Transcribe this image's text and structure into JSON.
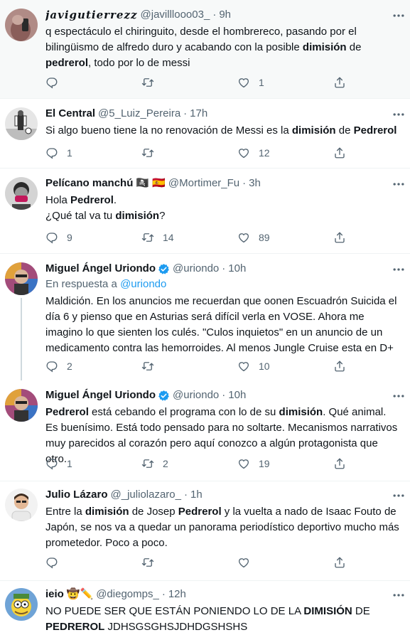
{
  "tweets": [
    {
      "name": "javigutierrezz",
      "handle": "@javilllooo03_",
      "time": "9h",
      "text_html": "q espectáculo el chiringuito, desde el hombrereco, pasando por el bilingüismo de alfredo duro y acabando con la posible <b>dimisión</b> de <b>pedrerol</b>, todo por lo de messi",
      "replies": "",
      "retweets": "",
      "likes": "1"
    },
    {
      "name": "El Central",
      "handle": "@5_Luiz_Pereira",
      "time": "17h",
      "text_html": "Si algo bueno tiene la no renovación de Messi es la <b>dimisión</b> de <b>Pedrerol</b>",
      "replies": "1",
      "retweets": "",
      "likes": "12"
    },
    {
      "name": "Pelícano manchú",
      "name_emoji": "🏴‍☠️ 🇪🇸",
      "handle": "@Mortimer_Fu",
      "time": "3h",
      "text_html": "Hola <b>Pedrerol</b>.<br>¿Qué tal va tu <b>dimisión</b>?",
      "replies": "9",
      "retweets": "14",
      "likes": "89"
    },
    {
      "name": "Miguel Ángel Uriondo",
      "handle": "@uriondo",
      "time": "10h",
      "reply_prefix": "En respuesta a",
      "reply_to": "@uriondo",
      "text_html": "Maldición. En los anuncios me recuerdan que oonen Escuadrón Suicida el día 6 y pienso que en Asturias será difícil verla en VOSE. Ahora me imagino lo que sienten los culés. \"Culos inquietos\" en un anuncio de un medicamento contra las hemorroides. Al menos Jungle Cruise esta en D+",
      "replies": "2",
      "retweets": "",
      "likes": "10"
    },
    {
      "name": "Miguel Ángel Uriondo",
      "handle": "@uriondo",
      "time": "10h",
      "text_html": "<b>Pedrerol</b> está cebando el programa con lo de su <b>dimisión</b>. Qué animal. Es buenísimo. Está todo pensado para no soltarte. Mecanismos narrativos muy parecidos al corazón pero aquí conozco a algún protagonista que otro.",
      "replies": "1",
      "retweets": "2",
      "likes": "19"
    },
    {
      "name": "Julio Lázaro",
      "handle": "@_juliolazaro_",
      "time": "1h",
      "text_html": "Entre la <b>dimisión</b> de Josep <b>Pedrerol</b> y la vuelta a nado de Isaac Fouto de Japón, se nos va a quedar un panorama periodístico deportivo mucho más prometedor. Poco a poco.",
      "replies": "",
      "retweets": "",
      "likes": ""
    },
    {
      "name": "ieio",
      "name_emoji": "🤠✏️",
      "handle": "@diegomps_",
      "time": "12h",
      "text_html": "NO PUEDE SER QUE ESTÁN PONIENDO LO DE LA <b>DIMISIÓN</b> DE <b>PEDREROL</b> JDHSGSGHSJDHDGSHSHS",
      "replies": "",
      "retweets": "",
      "likes": ""
    }
  ],
  "colors": {
    "text": "#0f1419",
    "secondary": "#536471",
    "link": "#1d9bf0",
    "divider": "#eff3f4",
    "shaded_bg": "#f7f9f9"
  },
  "icons": [
    "more-icon",
    "reply-icon",
    "retweet-icon",
    "like-icon",
    "share-icon",
    "verified-badge-icon"
  ]
}
